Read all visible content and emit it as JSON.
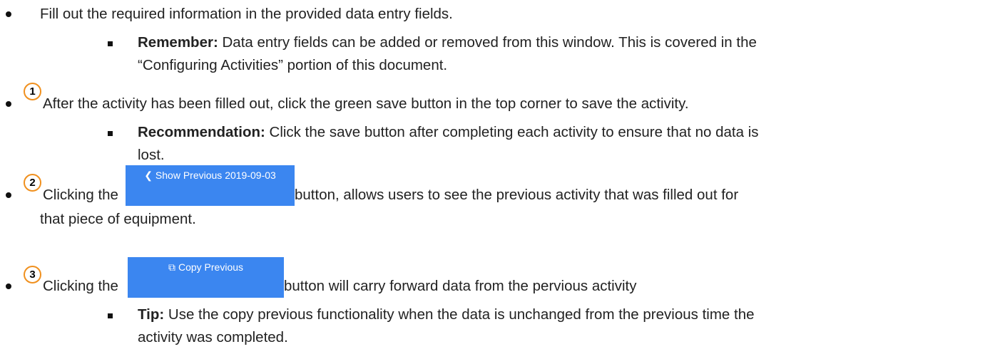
{
  "items": {
    "fill_out": "Fill out the required information in the provided data entry fields.",
    "remember_label": "Remember:",
    "remember_text_1": " Data entry fields can be added or removed from this window. This is covered in the",
    "remember_text_2": "“Configuring Activities” portion of this document.",
    "step1_number": "1",
    "step1_text": "After the activity has been filled out, click the green save button in the top corner to save the activity.",
    "recommendation_label": "Recommendation:",
    "recommendation_text_1": " Click the save button after completing each activity to ensure that no data is",
    "recommendation_text_2": "lost.",
    "step2_number": "2",
    "step2_prefix": "Clicking the",
    "step2_suffix": "button, allows users to see the previous activity that was filled out for",
    "step2_suffix_2": "that piece of equipment.",
    "step3_number": "3",
    "step3_prefix": "Clicking the",
    "step3_suffix": "button will carry forward data from the pervious activity",
    "tip_label": "Tip:",
    "tip_text_1": " Use the copy previous functionality when the data is unchanged from the previous time the",
    "tip_text_2": "activity was completed."
  },
  "buttons": {
    "show_previous_label": "Show Previous 2019-09-03",
    "show_previous_icon": "chevron-left-icon",
    "copy_previous_label": "Copy Previous",
    "copy_previous_icon": "copy-icon"
  },
  "colors": {
    "button_blue": "#3b86f0",
    "circle_orange": "#f0901e"
  }
}
